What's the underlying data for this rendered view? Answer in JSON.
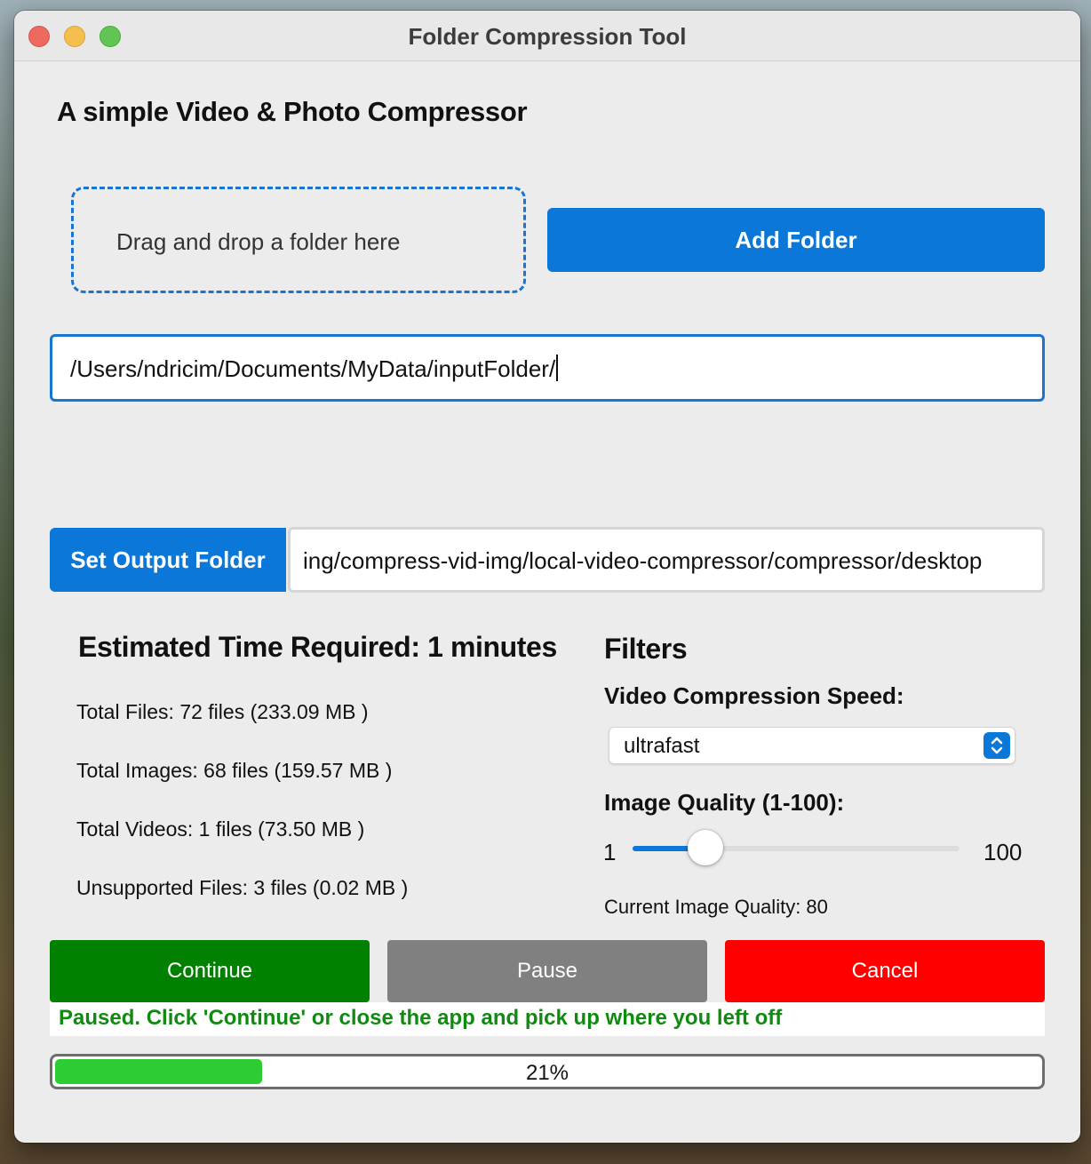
{
  "window": {
    "title": "Folder Compression Tool"
  },
  "header": {
    "subtitle": "A simple Video & Photo Compressor"
  },
  "input": {
    "dropzone_label": "Drag and drop a folder here",
    "add_folder_label": "Add Folder",
    "path_value": "/Users/ndricim/Documents/MyData/inputFolder/"
  },
  "output": {
    "set_output_label": "Set Output Folder",
    "path_value": "ing/compress-vid-img/local-video-compressor/compressor/desktop"
  },
  "summary": {
    "estimated_time": "Estimated Time Required: 1 minutes",
    "total_files": "Total Files: 72 files (233.09 MB )",
    "total_images": "Total Images: 68 files (159.57 MB )",
    "total_videos": "Total Videos: 1 files (73.50 MB )",
    "unsupported_files": "Unsupported Files: 3 files (0.02 MB )"
  },
  "filters": {
    "heading": "Filters",
    "video_speed_label": "Video Compression Speed:",
    "video_speed_value": "ultrafast",
    "image_quality_label": "Image Quality (1-100):",
    "slider_min": "1",
    "slider_max": "100",
    "current_quality": "Current Image Quality: 80"
  },
  "actions": {
    "continue_label": "Continue",
    "pause_label": "Pause",
    "cancel_label": "Cancel"
  },
  "status": {
    "message": "Paused. Click 'Continue' or close the app and pick up where you left off"
  },
  "progress": {
    "percent_label": "21%",
    "fraction": 0.21
  },
  "colors": {
    "accent": "#0b78d9",
    "continue": "#028002",
    "pause": "#808080",
    "cancel": "#fe0000",
    "status_text": "#108a10",
    "progress_fill": "#2ecc33"
  }
}
